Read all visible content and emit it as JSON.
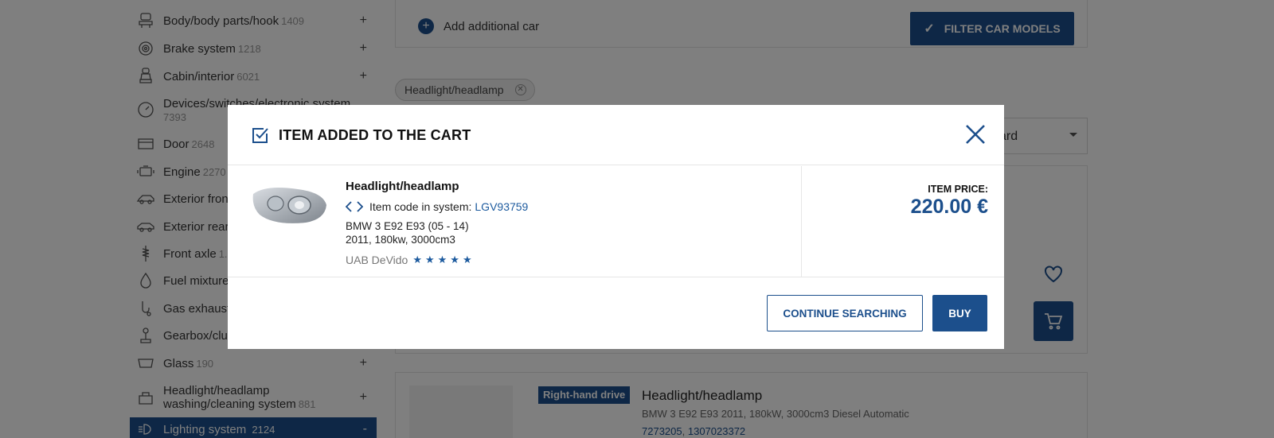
{
  "sidebar": {
    "items": [
      {
        "label": "Body/body parts/hook",
        "count": "1409",
        "icon": "car-lift-icon"
      },
      {
        "label": "Brake system",
        "count": "1218",
        "icon": "brake-disc-icon"
      },
      {
        "label": "Cabin/interior",
        "count": "6021",
        "icon": "car-seat-icon"
      },
      {
        "label": "Devices/switches/electronic system",
        "count": "7393",
        "icon": "gauge-icon"
      },
      {
        "label": "Door",
        "count": "2648",
        "icon": "car-door-icon"
      },
      {
        "label": "Engine",
        "count": "2270",
        "icon": "engine-icon"
      },
      {
        "label": "Exterior fron",
        "count": "",
        "icon": "car-front-icon"
      },
      {
        "label": "Exterior rear",
        "count": "",
        "icon": "car-rear-icon"
      },
      {
        "label": "Front axle",
        "count": "1.",
        "icon": "suspension-icon"
      },
      {
        "label": "Fuel mixture",
        "count": "",
        "icon": "fuel-drop-icon"
      },
      {
        "label": "Gas exhaust",
        "count": "",
        "icon": "exhaust-icon"
      },
      {
        "label": "Gearbox/clu",
        "count": "",
        "icon": "gear-stick-icon"
      },
      {
        "label": "Glass",
        "count": "190",
        "icon": "windshield-icon"
      },
      {
        "label": "Headlight/headlamp washing/cleaning system",
        "count": "881",
        "icon": "washer-icon"
      },
      {
        "label": "Lighting system",
        "count": "2124",
        "icon": "headlight-icon"
      }
    ],
    "plus": "+",
    "minus": "-"
  },
  "filters": {
    "add_car_label": "Add additional car",
    "filter_button_label": "FILTER CAR MODELS",
    "chip_label": "Headlight/headlamp",
    "sort_value_fragment": "ard"
  },
  "result2": {
    "badge": "Right-hand drive",
    "title": "Headlight/headlamp",
    "desc": "BMW 3 E92 E93 2011, 180kW, 3000cm3 Diesel Automatic",
    "code1": "7273205",
    "code2": "1307023372"
  },
  "modal": {
    "title": "ITEM ADDED TO THE CART",
    "product_name": "Headlight/headlamp",
    "code_label": "Item code in system:",
    "code_value": "LGV93759",
    "car_model": "BMW 3 E92 E93 (05 - 14)",
    "car_specs": "2011, 180kw, 3000cm3",
    "seller": "UAB DeVido",
    "stars": "★★★★★",
    "rating": 5,
    "price_label": "ITEM PRICE:",
    "price_value": "220.00 €",
    "continue_label": "CONTINUE SEARCHING",
    "buy_label": "BUY"
  },
  "colors": {
    "brand": "#1c4f8c",
    "link": "#1c5a9e",
    "overlay": "rgba(0,0,0,0.5)"
  }
}
